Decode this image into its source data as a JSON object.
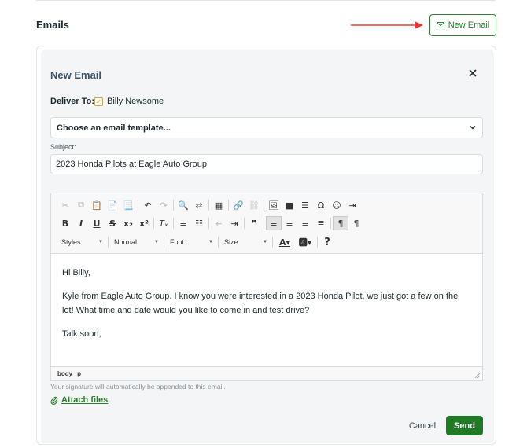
{
  "section": {
    "title": "Emails"
  },
  "new_email_button": {
    "label": "New Email",
    "icon": "envelope-icon"
  },
  "annotation": {
    "arrow_color": "#e53935"
  },
  "panel": {
    "title": "New Email",
    "close_icon": "close-icon",
    "deliver_to": {
      "label": "Deliver To:",
      "recipient": "Billy Newsome",
      "checked": true
    },
    "template_select": {
      "value": "Choose an email template..."
    },
    "subject": {
      "label": "Subject:",
      "value": "2023 Honda Pilots at Eagle Auto Group"
    },
    "toolbar": {
      "styles_label": "Styles",
      "format_label": "Normal",
      "font_label": "Font",
      "size_label": "Size",
      "help_label": "?"
    },
    "body": {
      "greeting": "Hi Billy,",
      "message": "Kyle from Eagle Auto Group. I know you were interested in a 2023 Honda Pilot, we just got a few on the lot! What time and date would you like to come in and test drive?",
      "closing": "Talk soon,"
    },
    "status_bar": {
      "path": [
        "body",
        "p"
      ]
    },
    "signature_note": "Your signature will automatically be appended to this email.",
    "attach_label": "Attach files",
    "cancel_label": "Cancel",
    "send_label": "Send"
  },
  "colors": {
    "accent": "#2e7d32",
    "send_bg": "#1f7a24",
    "panel_title": "#3b5566"
  }
}
